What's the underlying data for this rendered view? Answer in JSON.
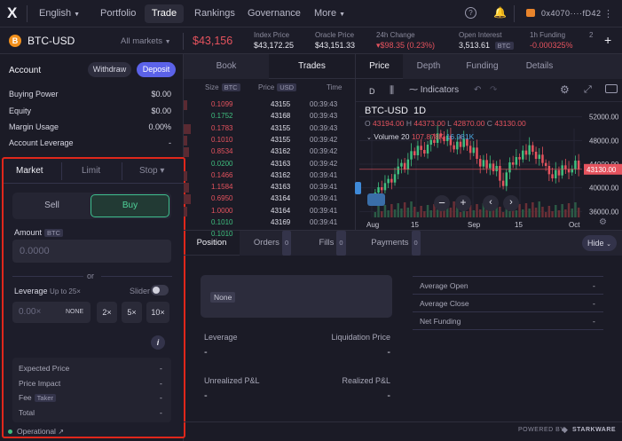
{
  "nav": {
    "logo": "X",
    "language": "English",
    "items": [
      "Portfolio",
      "Trade",
      "Rankings",
      "Governance",
      "More"
    ],
    "wallet": "0x4070····fD42"
  },
  "market": {
    "pair": "BTC-USD",
    "all_markets": "All markets",
    "price": "$43,156",
    "stats": [
      {
        "label": "Index Price",
        "value": "$43,172.25"
      },
      {
        "label": "Oracle Price",
        "value": "$43,151.33"
      },
      {
        "label": "24h Change",
        "value": "▾$98.35 (0.23%)"
      },
      {
        "label": "Open Interest",
        "value": "3,513.61",
        "badge": "BTC"
      },
      {
        "label": "1h Funding",
        "value": "-0.000325%"
      }
    ]
  },
  "account": {
    "title": "Account",
    "withdraw": "Withdraw",
    "deposit": "Deposit",
    "rows": [
      {
        "label": "Buying Power",
        "value": "$0.00"
      },
      {
        "label": "Equity",
        "value": "$0.00"
      },
      {
        "label": "Margin Usage",
        "value": "0.00%"
      },
      {
        "label": "Account Leverage",
        "value": "-"
      }
    ]
  },
  "order": {
    "tabs": [
      "Market",
      "Limit",
      "Stop ▾"
    ],
    "sell": "Sell",
    "buy": "Buy",
    "amount_label": "Amount",
    "amount_unit": "BTC",
    "amount_placeholder": "0.0000",
    "or": "or",
    "leverage_label": "Leverage",
    "leverage_hint": "Up to 25×",
    "slider_label": "Slider",
    "leverage_placeholder": "0.00×",
    "none": "NONE",
    "presets": [
      "2×",
      "5×",
      "10×"
    ],
    "info": "i",
    "summary": [
      {
        "label": "Expected Price",
        "value": "-"
      },
      {
        "label": "Price Impact",
        "value": "-"
      },
      {
        "label": "Fee",
        "badge": "Taker",
        "value": "-"
      },
      {
        "label": "Total",
        "value": "-"
      }
    ]
  },
  "book": {
    "tabs": [
      "Book",
      "Trades"
    ],
    "headers": {
      "size": "Size",
      "size_unit": "BTC",
      "price": "Price",
      "price_unit": "USD",
      "time": "Time"
    },
    "rows": [
      {
        "size": "0.1099",
        "price": "43155",
        "time": "00:39:43",
        "side": "sell"
      },
      {
        "size": "0.1752",
        "price": "43168",
        "time": "00:39:43",
        "side": "buy"
      },
      {
        "size": "0.1783",
        "price": "43155",
        "time": "00:39:43",
        "side": "sell"
      },
      {
        "size": "0.1010",
        "price": "43155",
        "time": "00:39:42",
        "side": "sell"
      },
      {
        "size": "0.8534",
        "price": "43162",
        "time": "00:39:42",
        "side": "sell"
      },
      {
        "size": "0.0200",
        "price": "43163",
        "time": "00:39:42",
        "side": "buy"
      },
      {
        "size": "0.1466",
        "price": "43162",
        "time": "00:39:41",
        "side": "sell"
      },
      {
        "size": "1.1584",
        "price": "43163",
        "time": "00:39:41",
        "side": "sell"
      },
      {
        "size": "0.6950",
        "price": "43164",
        "time": "00:39:41",
        "side": "sell"
      },
      {
        "size": "1.0000",
        "price": "43164",
        "time": "00:39:41",
        "side": "sell"
      },
      {
        "size": "0.1010",
        "price": "43169",
        "time": "00:39:41",
        "side": "buy"
      },
      {
        "size": "0.1010",
        "price": "43169",
        "time": "00:39:41",
        "side": "buy"
      }
    ]
  },
  "chart_tabs": [
    "Price",
    "Depth",
    "Funding",
    "Details"
  ],
  "chart_toolbar": {
    "interval": "D",
    "indicators": "Indicators"
  },
  "chart_data": {
    "type": "candlestick",
    "title": "BTC-USD",
    "interval": "1D",
    "ohlc": {
      "o": "O",
      "o_val": "43194.00",
      "h": "H",
      "h_val": "44373.00",
      "l": "L",
      "l_val": "42870.00",
      "c": "C",
      "c_val": "43130.00"
    },
    "volume": {
      "label": "Volume",
      "period": "20",
      "v1": "107.878K",
      "v2": "16.981K"
    },
    "ylabels": [
      "52000.00",
      "48000.00",
      "44000.00",
      "40000.00",
      "36000.00"
    ],
    "last_price": "43130.00",
    "xlabels": [
      "Aug",
      "15",
      "Sep",
      "15",
      "Oct"
    ],
    "ylim": [
      35000,
      54500
    ]
  },
  "positions": {
    "tabs": [
      {
        "label": "Position"
      },
      {
        "label": "Orders",
        "count": "0"
      },
      {
        "label": "Fills",
        "count": "0"
      },
      {
        "label": "Payments",
        "count": "0"
      }
    ],
    "hide": "Hide",
    "none": "None",
    "fields": [
      {
        "label": "Leverage",
        "value": "-"
      },
      {
        "label": "Liquidation Price",
        "value": "-"
      },
      {
        "label": "Unrealized P&L",
        "value": "-"
      },
      {
        "label": "Realized P&L",
        "value": "-"
      }
    ],
    "side": [
      {
        "label": "Average Open",
        "value": "-"
      },
      {
        "label": "Average Close",
        "value": "-"
      },
      {
        "label": "Net Funding",
        "value": "-"
      }
    ]
  },
  "footer": {
    "status": "Operational",
    "powered": "POWERED BY",
    "brand": "STARKWARE"
  }
}
